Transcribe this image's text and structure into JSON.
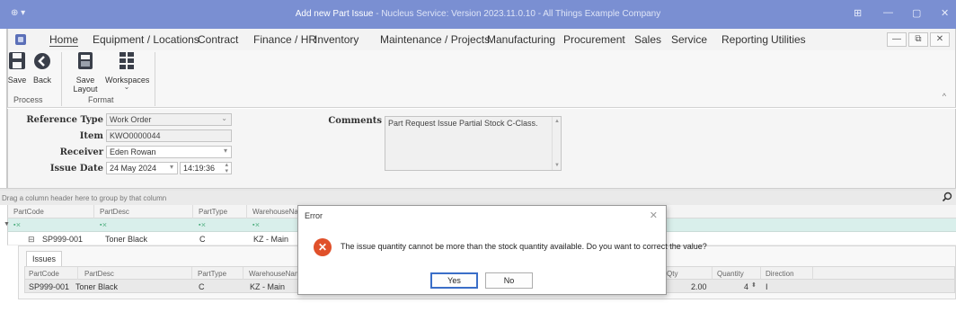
{
  "window": {
    "system_menu": "⊕ ▾",
    "title_main": "Add new Part Issue",
    "title_suffix": " - Nucleus Service: Version 2023.11.0.10 - All Things Example Company",
    "controls": {
      "restore_extra": "⊞",
      "minimize": "—",
      "maximize": "▢",
      "close": "✕"
    }
  },
  "menu": {
    "items": [
      "Home",
      "Equipment / Locations",
      "Contract",
      "Finance / HR",
      "Inventory",
      "Maintenance / Projects",
      "Manufacturing",
      "Procurement",
      "Sales",
      "Service",
      "Reporting",
      "Utilities"
    ],
    "mdi": {
      "minimize": "—",
      "restore": "⧉",
      "close": "✕"
    }
  },
  "ribbon": {
    "buttons": [
      {
        "label": "Save",
        "icon": "save-icon"
      },
      {
        "label": "Back",
        "icon": "back-icon"
      },
      {
        "label": "Save Layout",
        "icon": "save-layout-icon"
      },
      {
        "label": "Workspaces",
        "icon": "workspaces-icon"
      }
    ],
    "workspaces_arrow": "⌄",
    "groups": [
      "Process",
      "Format"
    ],
    "collapse": "^"
  },
  "form": {
    "reference_type": {
      "label": "Reference Type",
      "value": "Work Order"
    },
    "item": {
      "label": "Item",
      "value": "KWO0000044"
    },
    "receiver": {
      "label": "Receiver",
      "value": "Eden Rowan"
    },
    "issue_date": {
      "label": "Issue Date",
      "date": "24 May 2024",
      "time": "14:19:36"
    },
    "comments": {
      "label": "Comments",
      "value": "Part Request Issue Partial Stock C-Class."
    }
  },
  "grid": {
    "group_hint": "Drag a column header here to group by that column",
    "columns": [
      "PartCode",
      "PartDesc",
      "PartType",
      "WarehouseNam"
    ],
    "filter_mark": "▪⨯",
    "filter_funnel": "▼",
    "row": {
      "expander": "⊟",
      "code": "SP999-001",
      "desc": "Toner Black",
      "type": "C",
      "warehouse": "KZ - Main"
    }
  },
  "detail": {
    "tab": "Issues",
    "columns": [
      "PartCode",
      "PartDesc",
      "PartType",
      "WarehouseNam",
      "StockQty",
      "Quantity",
      "Direction"
    ],
    "row": {
      "code": "SP999-001",
      "desc": "Toner Black",
      "type": "C",
      "warehouse": "KZ - Main",
      "stock_qty": "2.00",
      "quantity": "4",
      "direction": "I"
    }
  },
  "dialog": {
    "title": "Error",
    "close": "✕",
    "message": "The issue quantity cannot be more than the stock quantity available. Do you want to correct the value?",
    "yes": "Yes",
    "no": "No"
  },
  "colors": {
    "titlebar": "#7a8fd2",
    "error": "#e0502a",
    "filter_row": "#d9efeb"
  }
}
